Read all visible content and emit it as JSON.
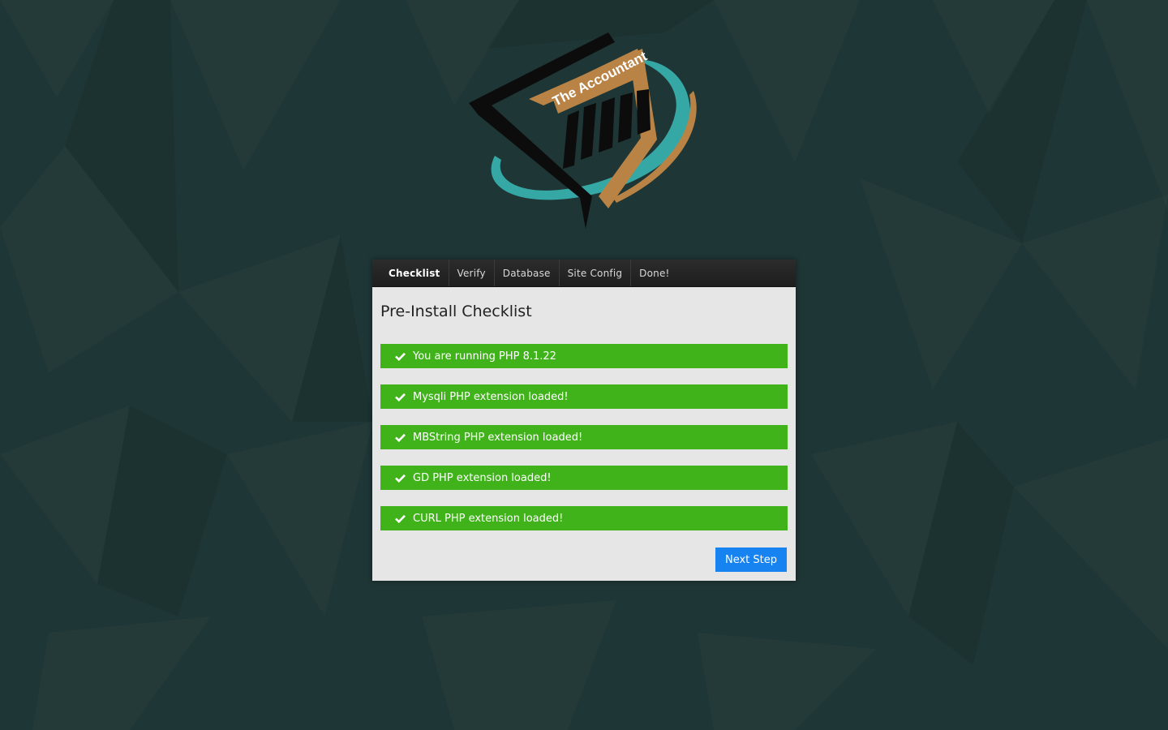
{
  "logo": {
    "text": "The Accountant",
    "colors": {
      "teal": "#35a8a6",
      "gold": "#b98345",
      "black": "#0c0c0c"
    }
  },
  "tabs": [
    {
      "label": "Checklist",
      "active": true
    },
    {
      "label": "Verify",
      "active": false
    },
    {
      "label": "Database",
      "active": false
    },
    {
      "label": "Site Config",
      "active": false
    },
    {
      "label": "Done!",
      "active": false
    }
  ],
  "main": {
    "heading": "Pre-Install Checklist",
    "checks": [
      {
        "text": "You are running PHP 8.1.22",
        "icon": "check-icon"
      },
      {
        "text": "Mysqli PHP extension loaded!",
        "icon": "check-icon"
      },
      {
        "text": "MBString PHP extension loaded!",
        "icon": "check-icon"
      },
      {
        "text": "GD PHP extension loaded!",
        "icon": "check-icon"
      },
      {
        "text": "CURL PHP extension loaded!",
        "icon": "check-icon"
      }
    ],
    "next_button": "Next Step"
  },
  "colors": {
    "background": "#1e3635",
    "success": "#40b31b",
    "primary": "#1683f0",
    "panel": "#e6e6e6"
  }
}
